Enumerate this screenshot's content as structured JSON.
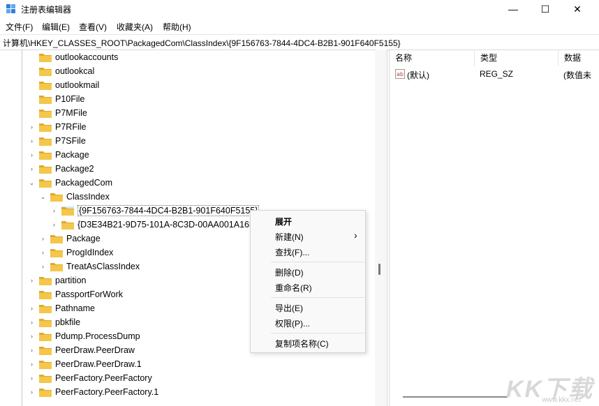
{
  "window": {
    "title": "注册表编辑器",
    "controls": {
      "minimize": "—",
      "maximize": "☐",
      "close": "✕"
    }
  },
  "menu": [
    "文件(F)",
    "编辑(E)",
    "查看(V)",
    "收藏夹(A)",
    "帮助(H)"
  ],
  "address": "计算机\\HKEY_CLASSES_ROOT\\PackagedCom\\ClassIndex\\{9F156763-7844-4DC4-B2B1-901F640F5155}",
  "tree": [
    {
      "label": "outlookaccounts",
      "expander": ""
    },
    {
      "label": "outlookcal",
      "expander": ""
    },
    {
      "label": "outlookmail",
      "expander": ""
    },
    {
      "label": "P10File",
      "expander": ""
    },
    {
      "label": "P7MFile",
      "expander": ""
    },
    {
      "label": "P7RFile",
      "expander": "›"
    },
    {
      "label": "P7SFile",
      "expander": "›"
    },
    {
      "label": "Package",
      "expander": "›"
    },
    {
      "label": "Package2",
      "expander": "›"
    },
    {
      "label": "PackagedCom",
      "expander": "⌄"
    },
    {
      "label": "ClassIndex",
      "expander": "⌄"
    },
    {
      "label": "{9F156763-7844-4DC4-B2B1-901F640F5155}",
      "expander": "›"
    },
    {
      "label": "{D3E34B21-9D75-101A-8C3D-00AA001A1652}",
      "expander": "›"
    },
    {
      "label": "Package",
      "expander": "›"
    },
    {
      "label": "ProgIdIndex",
      "expander": "›"
    },
    {
      "label": "TreatAsClassIndex",
      "expander": "›"
    },
    {
      "label": "partition",
      "expander": "›"
    },
    {
      "label": "PassportForWork",
      "expander": ""
    },
    {
      "label": "Pathname",
      "expander": "›"
    },
    {
      "label": "pbkfile",
      "expander": "›"
    },
    {
      "label": "Pdump.ProcessDump",
      "expander": "›"
    },
    {
      "label": "PeerDraw.PeerDraw",
      "expander": "›"
    },
    {
      "label": "PeerDraw.PeerDraw.1",
      "expander": "›"
    },
    {
      "label": "PeerFactory.PeerFactory",
      "expander": "›"
    },
    {
      "label": "PeerFactory.PeerFactory.1",
      "expander": "›"
    }
  ],
  "columns": [
    "名称",
    "类型",
    "数据"
  ],
  "values": [
    {
      "name": "(默认)",
      "type": "REG_SZ",
      "data": "(数值未"
    }
  ],
  "context_menu": {
    "expand": "展开",
    "new": "新建(N)",
    "new_arrow": "›",
    "find": "查找(F)...",
    "delete": "删除(D)",
    "rename": "重命名(R)",
    "export": "导出(E)",
    "permissions": "权限(P)...",
    "copy_key_name": "复制项名称(C)"
  },
  "watermark": {
    "brand": "KK下载",
    "url": "www.kkx.net"
  },
  "colors": {
    "folder": "#f4c64a",
    "folder_dark": "#e0a92a",
    "selection": "#cde8ff"
  }
}
